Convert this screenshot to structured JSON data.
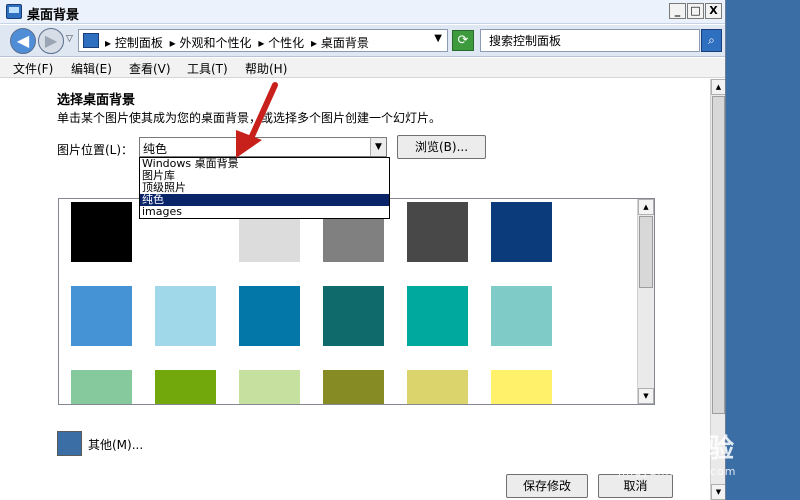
{
  "window": {
    "title": "桌面背景"
  },
  "window_buttons": {
    "minimize": "_",
    "maximize": "□",
    "close": "X"
  },
  "nav": {
    "back_glyph": "◀",
    "forward_glyph": "▶",
    "history_glyph": "▽",
    "breadcrumbs": [
      "▸ 控制面板",
      "▸ 外观和个性化",
      "▸ 个性化",
      "▸ 桌面背景"
    ],
    "dropdown_glyph": "▼",
    "refresh_glyph": "⟳",
    "search_placeholder": "搜索控制面板",
    "search_glyph": "⌕"
  },
  "menu": [
    {
      "label": "文件(F)"
    },
    {
      "label": "编辑(E)"
    },
    {
      "label": "查看(V)"
    },
    {
      "label": "工具(T)"
    },
    {
      "label": "帮助(H)"
    }
  ],
  "content": {
    "heading": "选择桌面背景",
    "subtitle": "单击某个图片使其成为您的桌面背景，或选择多个图片创建一个幻灯片。",
    "location_label": "图片位置(L)：",
    "location_value": "纯色",
    "browse_label": "浏览(B)...",
    "dropdown_options": [
      "Windows 桌面背景",
      "图片库",
      "顶级照片",
      "纯色",
      "images"
    ],
    "selected_option": "纯色",
    "swatches": [
      {
        "color": "#000000"
      },
      {
        "color": "#ffffff"
      },
      {
        "color": "#dcdcdc"
      },
      {
        "color": "#808080"
      },
      {
        "color": "#484848"
      },
      {
        "color": "#0c3b7c"
      },
      {
        "color": "#4593d5"
      },
      {
        "color": "#a0d8ea"
      },
      {
        "color": "#0378a8"
      },
      {
        "color": "#0f6b6b"
      },
      {
        "color": "#00a99d"
      },
      {
        "color": "#7ecbc7"
      },
      {
        "color": "#85c99c"
      },
      {
        "color": "#72a80c"
      },
      {
        "color": "#c5e09f"
      },
      {
        "color": "#878b24"
      },
      {
        "color": "#dbd46c"
      },
      {
        "color": "#fff16a"
      }
    ],
    "other_label": "其他(M)...",
    "other_color": "#3a6ea5",
    "save_label": "保存修改",
    "cancel_label": "取消"
  },
  "watermark": {
    "logo": "Bai⊛经验",
    "url": "jingyan.baidu.com"
  }
}
